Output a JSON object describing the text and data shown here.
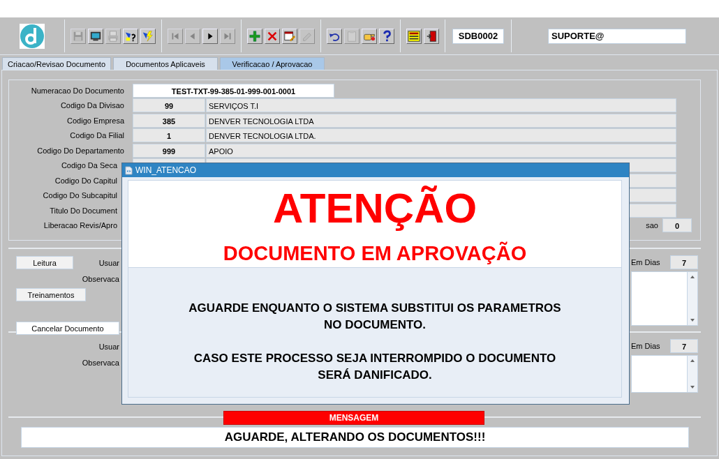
{
  "toolbar": {
    "groups": [
      [
        {
          "kind": "save",
          "disabled": true
        },
        {
          "kind": "screen",
          "disabled": false
        },
        {
          "kind": "print",
          "disabled": true
        },
        {
          "kind": "query",
          "disabled": false
        },
        {
          "kind": "execute",
          "disabled": false
        }
      ],
      [
        {
          "kind": "first",
          "disabled": true
        },
        {
          "kind": "prev",
          "disabled": true
        },
        {
          "kind": "next",
          "disabled": false
        },
        {
          "kind": "last",
          "disabled": true
        }
      ],
      [
        {
          "kind": "add",
          "disabled": false
        },
        {
          "kind": "delete",
          "disabled": false
        },
        {
          "kind": "edit",
          "disabled": false
        },
        {
          "kind": "erase",
          "disabled": true
        }
      ],
      [
        {
          "kind": "undo",
          "disabled": false
        },
        {
          "kind": "clipboard",
          "disabled": true
        },
        {
          "kind": "hand",
          "disabled": false
        },
        {
          "kind": "help",
          "disabled": false
        }
      ],
      [
        {
          "kind": "menu",
          "disabled": false
        },
        {
          "kind": "exit",
          "disabled": false
        }
      ]
    ],
    "screen_code": "SDB0002",
    "user": "SUPORTE@"
  },
  "tabs": [
    {
      "label": "Criacao/Revisao Documento",
      "selected": false
    },
    {
      "label": "Documentos Aplicaveis",
      "selected": false
    },
    {
      "label": "Verificacao / Aprovacao",
      "selected": true
    }
  ],
  "header_fields": [
    {
      "kind": "document",
      "label": "Numeracao Do Documento",
      "value": "TEST-TXT-99-385-01-999-001-0001"
    },
    {
      "kind": "coded",
      "label": "Codigo Da Divisao",
      "code": "99",
      "description": "SERVIÇOS T.I"
    },
    {
      "kind": "coded",
      "label": "Codigo Empresa",
      "code": "385",
      "description": "DENVER TECNOLOGIA LTDA"
    },
    {
      "kind": "coded",
      "label": "Codigo Da Filial",
      "code": "1",
      "description": "DENVER TECNOLOGIA LTDA."
    },
    {
      "kind": "coded",
      "label": "Codigo Do Departamento",
      "code": "999",
      "description": "APOIO"
    },
    {
      "kind": "coded",
      "label": "Codigo Da Seca"
    },
    {
      "kind": "covered",
      "label": "Codigo Do Capitul"
    },
    {
      "kind": "covered",
      "label": "Codigo Do Subcapitul"
    },
    {
      "kind": "covered",
      "label": "Titulo Do Document"
    },
    {
      "kind": "release",
      "label": "Liberacao Revis/Apro",
      "extra_label": "sao",
      "extra_value": "0"
    }
  ],
  "sections": [
    {
      "buttons": [
        {
          "label": "Leitura",
          "focused": false
        },
        {
          "label": "Treinamentos",
          "focused": false
        },
        {
          "label": "Cancelar Documento",
          "focused": true
        }
      ],
      "user_label": "Usuar",
      "notes_label": "Observaca",
      "days_label": "Em Dias",
      "days": "7"
    },
    {
      "user_label": "Usuar",
      "notes_label": "Observaca",
      "days_label": "Em Dias",
      "days": "7"
    }
  ],
  "message": {
    "title": "MENSAGEM",
    "text": "AGUARDE, ALTERANDO OS DOCUMENTOS!!!"
  },
  "dialog": {
    "title": "WIN_ATENCAO",
    "heading": "ATENÇÃO",
    "subheading": "DOCUMENTO EM APROVAÇÃO",
    "paragraphs": [
      "AGUARDE ENQUANTO O SISTEMA SUBSTITUI OS PARAMETROS NO DOCUMENTO.",
      "CASO ESTE PROCESSO SEJA INTERROMPIDO O DOCUMENTO SERÁ DANIFICADO."
    ]
  }
}
